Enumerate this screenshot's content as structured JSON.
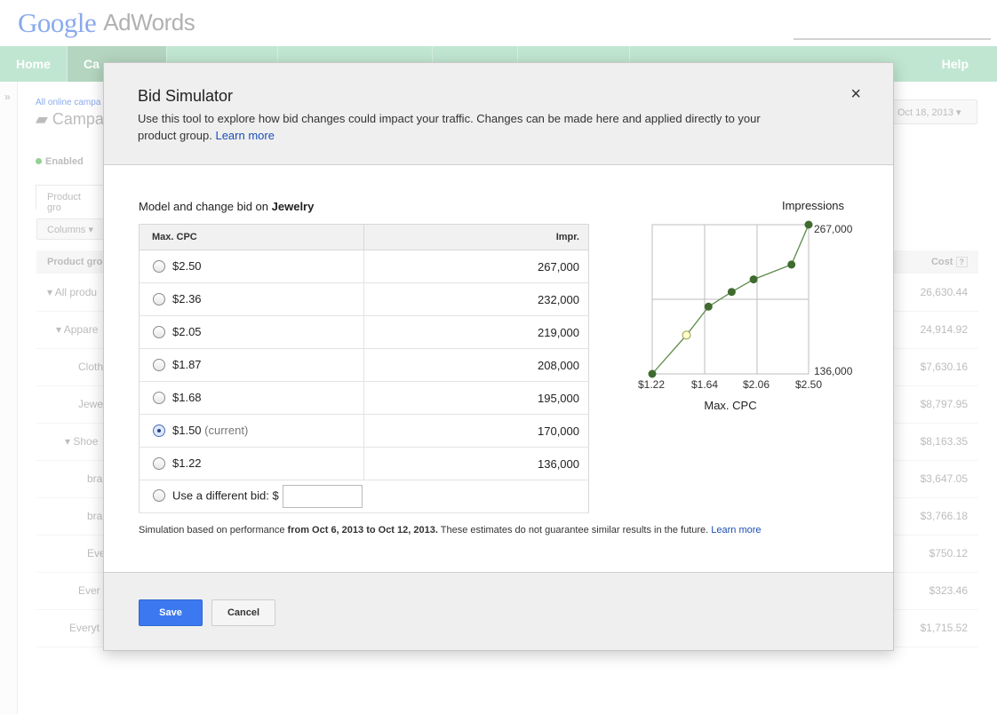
{
  "header": {
    "logo_google": "Google",
    "logo_product": "AdWords"
  },
  "nav": {
    "items": [
      "Home",
      "Ca",
      "",
      "",
      "",
      ""
    ],
    "help": "Help"
  },
  "background": {
    "breadcrumb": "All online campa",
    "title": "Campa",
    "status": "Enabled",
    "tab": "Product gro",
    "columns_button": "Columns",
    "date": "Oct 18, 2013",
    "table_head": {
      "name": "Product gro",
      "cost": "Cost"
    },
    "rows": [
      {
        "name": "All produ",
        "cost": "26,630.44"
      },
      {
        "name": "Appare",
        "cost": "24,914.92"
      },
      {
        "name": "Cloth",
        "cost": "$7,630.16"
      },
      {
        "name": "Jewe",
        "cost": "$8,797.95"
      },
      {
        "name": "Shoe",
        "cost": "$8,163.35"
      },
      {
        "name": "bra",
        "cost": "$3,647.05"
      },
      {
        "name": "bra",
        "cost": "$3,766.18"
      },
      {
        "name": "Eve",
        "cost": "$750.12"
      },
      {
        "name": "Ever",
        "cost": "$323.46"
      },
      {
        "name": "Everyt",
        "cost": "$1,715.52"
      }
    ]
  },
  "dialog": {
    "title": "Bid Simulator",
    "close_icon": "×",
    "description": "Use this tool to explore how bid changes could impact your traffic. Changes can be made here and applied directly to your product group.",
    "learn_more": "Learn more",
    "model_label": "Model and change bid on",
    "model_target": "Jewelry",
    "table": {
      "col_cpc": "Max. CPC",
      "col_impr": "Impr.",
      "rows": [
        {
          "cpc": "$2.50",
          "impr": "267,000",
          "note": ""
        },
        {
          "cpc": "$2.36",
          "impr": "232,000",
          "note": ""
        },
        {
          "cpc": "$2.05",
          "impr": "219,000",
          "note": ""
        },
        {
          "cpc": "$1.87",
          "impr": "208,000",
          "note": ""
        },
        {
          "cpc": "$1.68",
          "impr": "195,000",
          "note": ""
        },
        {
          "cpc": "$1.50",
          "impr": "170,000",
          "note": "(current)"
        },
        {
          "cpc": "$1.22",
          "impr": "136,000",
          "note": ""
        }
      ],
      "selected_index": 5,
      "custom_label": "Use a different bid: $",
      "custom_value": ""
    },
    "note_prefix": "Simulation based on performance",
    "note_range": "from Oct 6, 2013 to Oct 12, 2013.",
    "note_suffix": "These estimates do not guarantee similar results in the future.",
    "note_link": "Learn more",
    "save_label": "Save",
    "cancel_label": "Cancel"
  },
  "chart_data": {
    "type": "line",
    "title": "Impressions",
    "xlabel": "Max. CPC",
    "ylabel": "",
    "x_ticks": [
      "$1.22",
      "$1.64",
      "$2.06",
      "$2.50"
    ],
    "y_ticks": [
      "136,000",
      "267,000"
    ],
    "xlim": [
      1.22,
      2.5
    ],
    "ylim": [
      136000,
      267000
    ],
    "grid": true,
    "series": [
      {
        "points": [
          {
            "x": 1.22,
            "y": 136000
          },
          {
            "x": 1.5,
            "y": 170000
          },
          {
            "x": 1.68,
            "y": 195000
          },
          {
            "x": 1.87,
            "y": 208000
          },
          {
            "x": 2.05,
            "y": 219000
          },
          {
            "x": 2.36,
            "y": 232000
          },
          {
            "x": 2.5,
            "y": 267000
          }
        ],
        "highlight_x": 1.5
      }
    ],
    "colors": {
      "line": "#5a8a4a",
      "point": "#3f6b2e",
      "highlight_fill": "#ffffcc",
      "highlight_stroke": "#9a9a50",
      "grid": "#bdbdbd"
    }
  }
}
